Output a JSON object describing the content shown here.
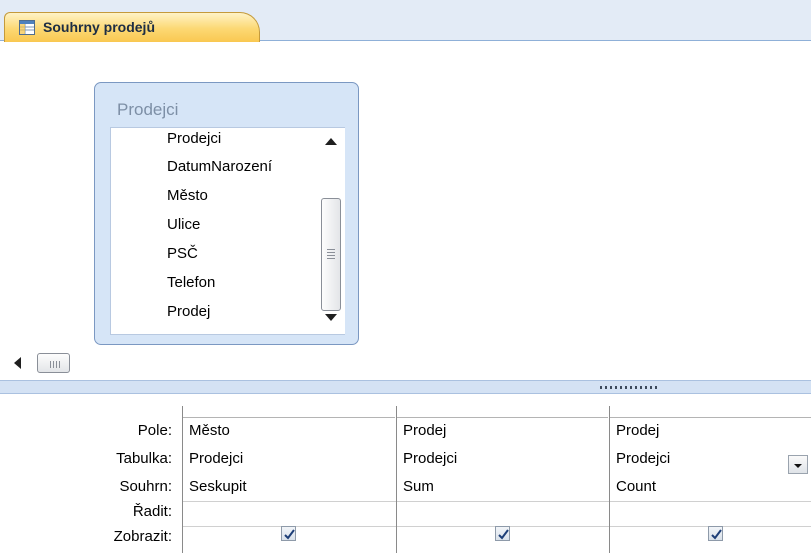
{
  "tab": {
    "label": "Souhrny prodejů",
    "icon": "query-icon"
  },
  "table_box": {
    "title": "Prodejci",
    "fields": [
      "Prodejci",
      "DatumNarození",
      "Město",
      "Ulice",
      "PSČ",
      "Telefon",
      "Prodej"
    ]
  },
  "grid": {
    "row_headers": [
      "Pole:",
      "Tabulka:",
      "Souhrn:",
      "Řadit:",
      "Zobrazit:"
    ],
    "columns": [
      {
        "pole": "Město",
        "tabulka": "Prodejci",
        "souhrn": "Seskupit",
        "radit": "",
        "zobrazit": true
      },
      {
        "pole": "Prodej",
        "tabulka": "Prodejci",
        "souhrn": "Sum",
        "radit": "",
        "zobrazit": true
      },
      {
        "pole": "Prodej",
        "tabulka": "Prodejci",
        "souhrn": "Count",
        "radit": "",
        "zobrazit": true
      }
    ]
  },
  "colors": {
    "tab_active": "#fcd873",
    "pane_background": "#d6e5f7",
    "splitter": "#d4e2f4"
  }
}
